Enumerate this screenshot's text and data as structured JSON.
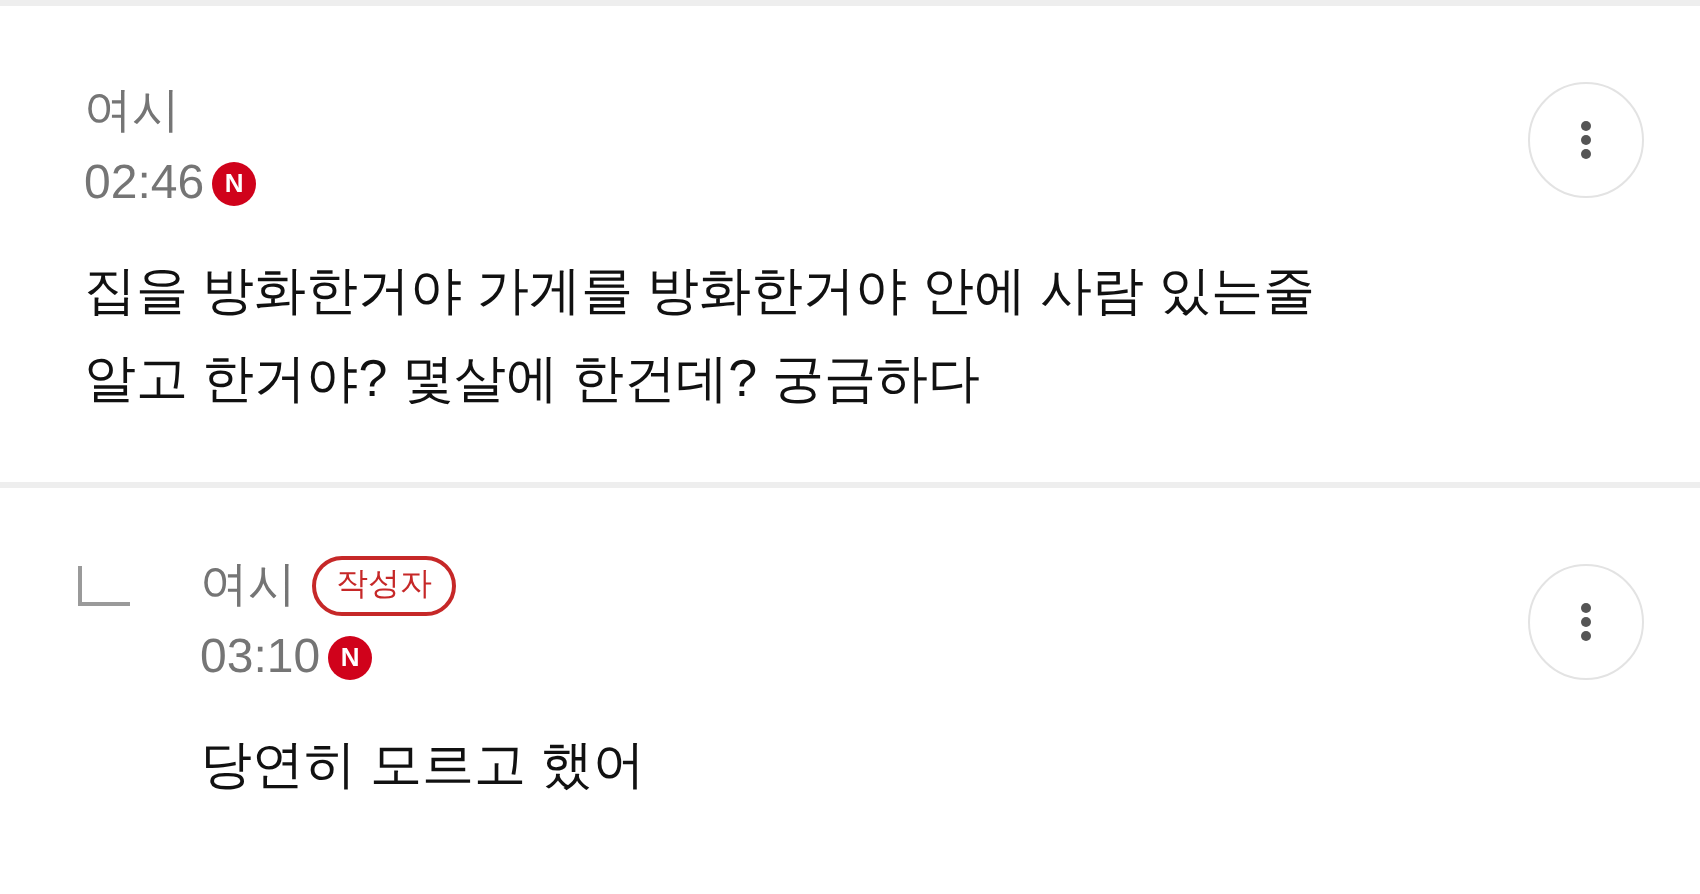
{
  "comments": [
    {
      "kind": "comment",
      "author": "여시",
      "time": "02:46",
      "new_mark": "N",
      "body": "집을 방화한거야 가게를 방화한거야 안에 사람 있는줄\n알고 한거야? 몇살에 한건데? 궁금하다"
    },
    {
      "kind": "reply",
      "author": "여시",
      "author_badge": "작성자",
      "time": "03:10",
      "new_mark": "N",
      "body": "당연히 모르고 했어"
    }
  ]
}
